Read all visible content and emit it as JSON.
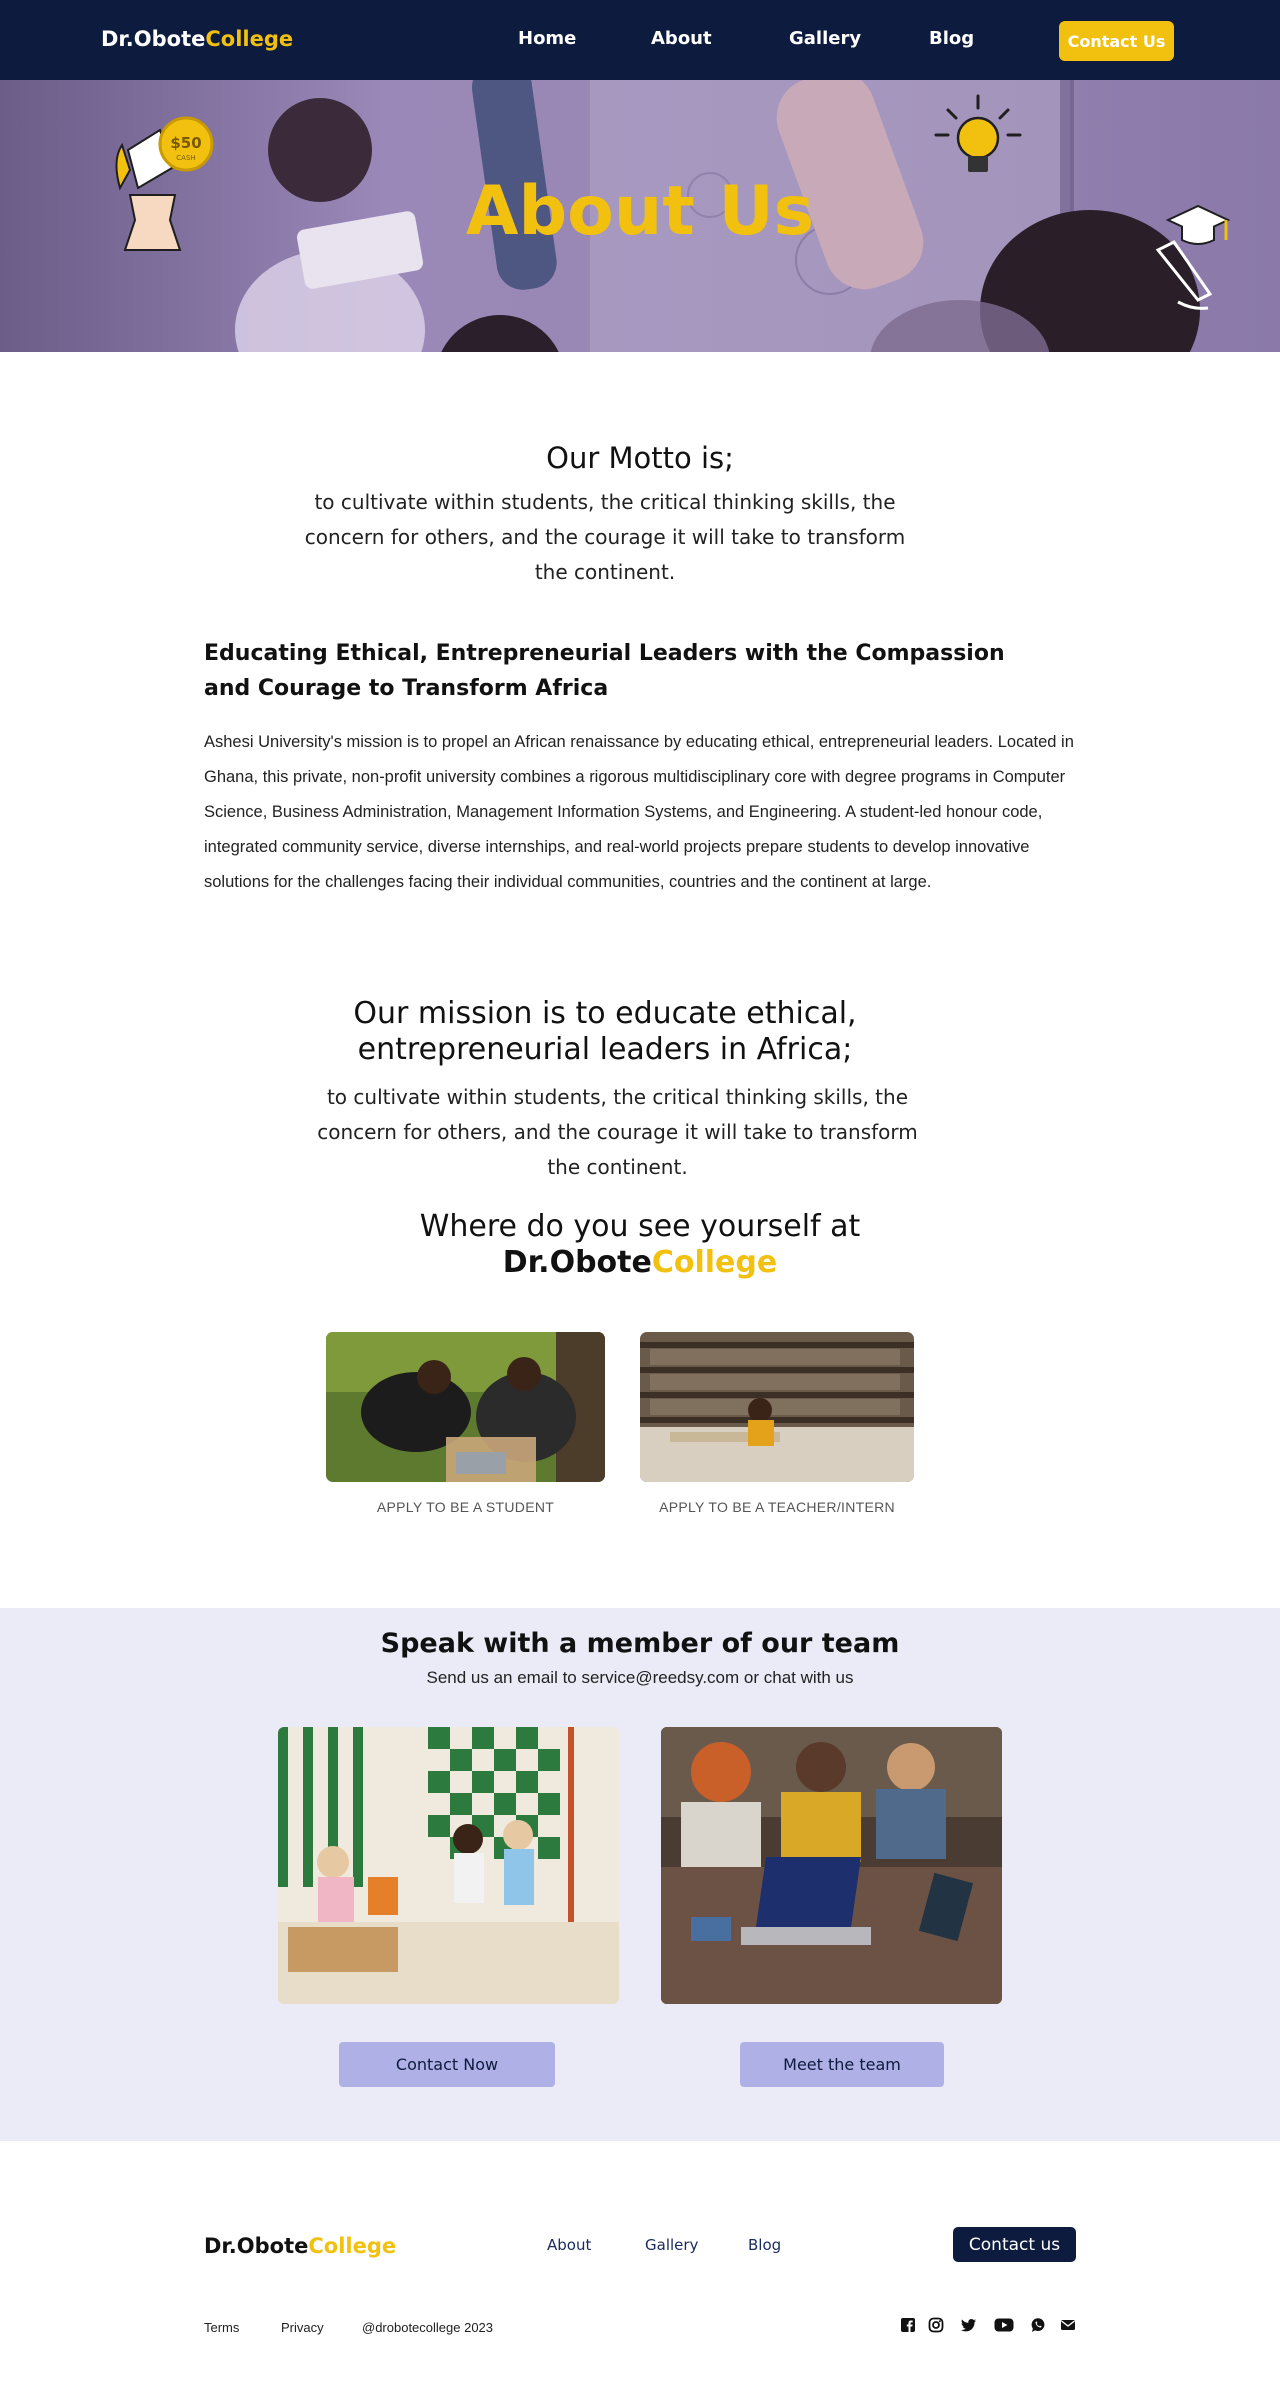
{
  "brand": {
    "part1": "Dr.Obote",
    "part2": "College"
  },
  "nav": {
    "links": [
      "Home",
      "About",
      "Gallery",
      "Blog"
    ],
    "cta": "Contact Us"
  },
  "hero": {
    "title": "About Us",
    "badge_amount": "$50",
    "badge_caption": "CASH"
  },
  "motto": {
    "title": "Our Motto is;",
    "body": "to cultivate within students, the critical thinking skills, the concern for others, and the courage it will take to transform the continent."
  },
  "education": {
    "heading": "Educating Ethical, Entrepreneurial Leaders with the Compassion and Courage to Transform Africa",
    "body": "Ashesi University's mission is to propel an African renaissance by educating ethical, entrepreneurial leaders. Located in Ghana, this private, non-profit university combines a rigorous multidisciplinary core with degree programs in Computer Science, Business Administration, Management Information Systems, and Engineering. A student-led honour code, integrated community service, diverse internships, and real-world projects prepare students to develop innovative solutions for the challenges facing their individual communities, countries and the continent at large."
  },
  "mission": {
    "title": "Our mission is to educate ethical, entrepreneurial leaders in Africa;",
    "body": "to cultivate within students, the critical thinking skills, the concern for others, and the courage it will take to transform the continent."
  },
  "where": {
    "title": "Where do you see yourself at",
    "student_label": "APPLY TO BE A STUDENT",
    "teacher_label": "APPLY TO BE A TEACHER/INTERN"
  },
  "team": {
    "title": "Speak with a member of our team",
    "subtitle": "Send us an email to service@reedsy.com or chat with us",
    "contact_button": "Contact Now",
    "meet_button": "Meet the team"
  },
  "footer": {
    "links": [
      "About",
      "Gallery",
      "Blog"
    ],
    "cta": "Contact us",
    "terms": "Terms",
    "privacy": "Privacy",
    "handle": "@drobotecollege 2023"
  },
  "colors": {
    "navy": "#0d1b3e",
    "accent": "#f2c10f",
    "team_bg": "#ebebf7",
    "button": "#aeb0e6"
  },
  "icons": [
    "facebook-icon",
    "instagram-icon",
    "twitter-icon",
    "youtube-icon",
    "whatsapp-icon",
    "mail-icon"
  ]
}
